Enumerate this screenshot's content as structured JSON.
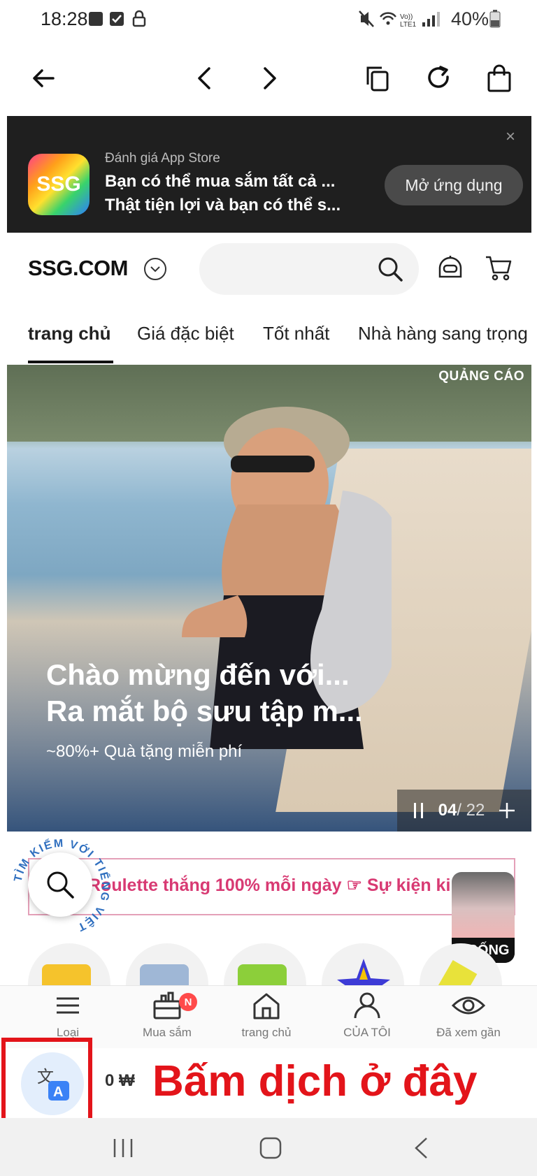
{
  "status_bar": {
    "time": "18:28",
    "battery": "40%"
  },
  "browser_toolbar": {
    "icons": [
      "arrow-left-icon",
      "chevron-left-icon",
      "chevron-right-icon",
      "copy-icon",
      "refresh-icon",
      "shopping-bag-icon"
    ]
  },
  "app_banner": {
    "icon_text": "SSG",
    "subtitle": "Đánh giá App Store",
    "line1": "Bạn có thể mua sắm tất cả ...",
    "line2": "Thật tiện lợi và bạn có thể s...",
    "open_button": "Mở ứng dụng",
    "close": "×"
  },
  "header": {
    "logo": "SSG.COM",
    "search_placeholder": ""
  },
  "tabs": [
    "trang chủ",
    "Giá đặc biệt",
    "Tốt nhất",
    "Nhà hàng sang trọng"
  ],
  "hero": {
    "ad_label": "QUẢNG CÁO",
    "title_line1": "Chào mừng đến với...",
    "title_line2": "Ra mắt bộ sưu tập m...",
    "subtitle": "~80%+ Quà tặng miễn phí",
    "pager_current": "04",
    "pager_total": "/ 22"
  },
  "promo": {
    "arc_text": "TÌM KIẾM VỚI TIẾNG VIỆT",
    "roulette_text": "Roulette thắng 100% mỗi ngày ☞ Sự kiện ki",
    "live_label": "SỐNG"
  },
  "bottom_nav": {
    "items": [
      {
        "label": "Loại",
        "icon": "menu-icon"
      },
      {
        "label": "Mua sắm",
        "icon": "shop-icon",
        "badge": "N"
      },
      {
        "label": "trang chủ",
        "icon": "home-icon"
      },
      {
        "label": "CỦA TÔI",
        "icon": "user-icon"
      },
      {
        "label": "Đã xem gần",
        "icon": "eye-icon"
      }
    ]
  },
  "translate": {
    "price": "0 ₩",
    "instruction": "Bấm dịch ở đây"
  },
  "colors": {
    "accent_red": "#e3141a",
    "roulette_pink": "#d83a73",
    "banner_bg": "#1f1f1f"
  }
}
